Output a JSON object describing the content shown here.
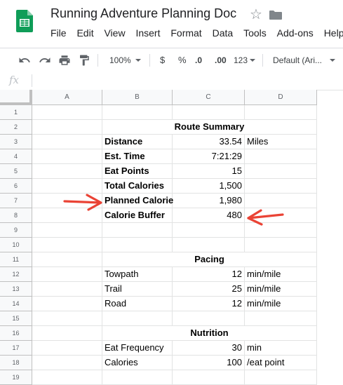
{
  "app": {
    "title": "Running Adventure Planning Doc",
    "menu": [
      "File",
      "Edit",
      "View",
      "Insert",
      "Format",
      "Data",
      "Tools",
      "Add-ons",
      "Help"
    ]
  },
  "toolbar": {
    "zoom": "100%",
    "currency": "$",
    "percent": "%",
    "decrease_decimal": ".0",
    "increase_decimal": ".00",
    "more_formats": "123",
    "font": "Default (Ari..."
  },
  "formula_bar": {
    "icon_label": "fx",
    "value": ""
  },
  "columns": [
    "A",
    "B",
    "C",
    "D"
  ],
  "rows": [
    {
      "n": "1",
      "b": "",
      "c": "",
      "d": ""
    },
    {
      "n": "2",
      "b": "",
      "c": "",
      "d": ""
    },
    {
      "n": "3",
      "b": "Distance",
      "c": "33.54",
      "d": "Miles"
    },
    {
      "n": "4",
      "b": "Est. Time",
      "c": "7:21:29",
      "d": ""
    },
    {
      "n": "5",
      "b": "Eat Points",
      "c": "15",
      "d": ""
    },
    {
      "n": "6",
      "b": "Total Calories",
      "c": "1,500",
      "d": ""
    },
    {
      "n": "7",
      "b": "Planned Calorie",
      "c": "1,980",
      "d": ""
    },
    {
      "n": "8",
      "b": "Calorie Buffer",
      "c": "480",
      "d": ""
    },
    {
      "n": "9",
      "b": "",
      "c": "",
      "d": ""
    },
    {
      "n": "10",
      "b": "",
      "c": "",
      "d": ""
    },
    {
      "n": "11",
      "b": "",
      "c": "",
      "d": ""
    },
    {
      "n": "12",
      "b": "Towpath",
      "c": "12",
      "d": "min/mile"
    },
    {
      "n": "13",
      "b": "Trail",
      "c": "25",
      "d": "min/mile"
    },
    {
      "n": "14",
      "b": "Road",
      "c": "12",
      "d": "min/mile"
    },
    {
      "n": "15",
      "b": "",
      "c": "",
      "d": ""
    },
    {
      "n": "16",
      "b": "",
      "c": "",
      "d": ""
    },
    {
      "n": "17",
      "b": "Eat Frequency",
      "c": "30",
      "d": "min"
    },
    {
      "n": "18",
      "b": "Calories",
      "c": "100",
      "d": "/eat point"
    },
    {
      "n": "19",
      "b": "",
      "c": "",
      "d": ""
    }
  ],
  "section_headers": [
    {
      "row": "2",
      "text": "Route Summary"
    },
    {
      "row": "11",
      "text": "Pacing"
    },
    {
      "row": "16",
      "text": "Nutrition"
    }
  ],
  "bold_rows": [
    "3",
    "4",
    "5",
    "6",
    "7",
    "8"
  ],
  "annotations": {
    "arrow_color": "#ea4335"
  },
  "colors": {
    "sheets_green": "#0f9d58",
    "grid_line": "#e2e3e3",
    "header_bg": "#f8f9fa"
  }
}
